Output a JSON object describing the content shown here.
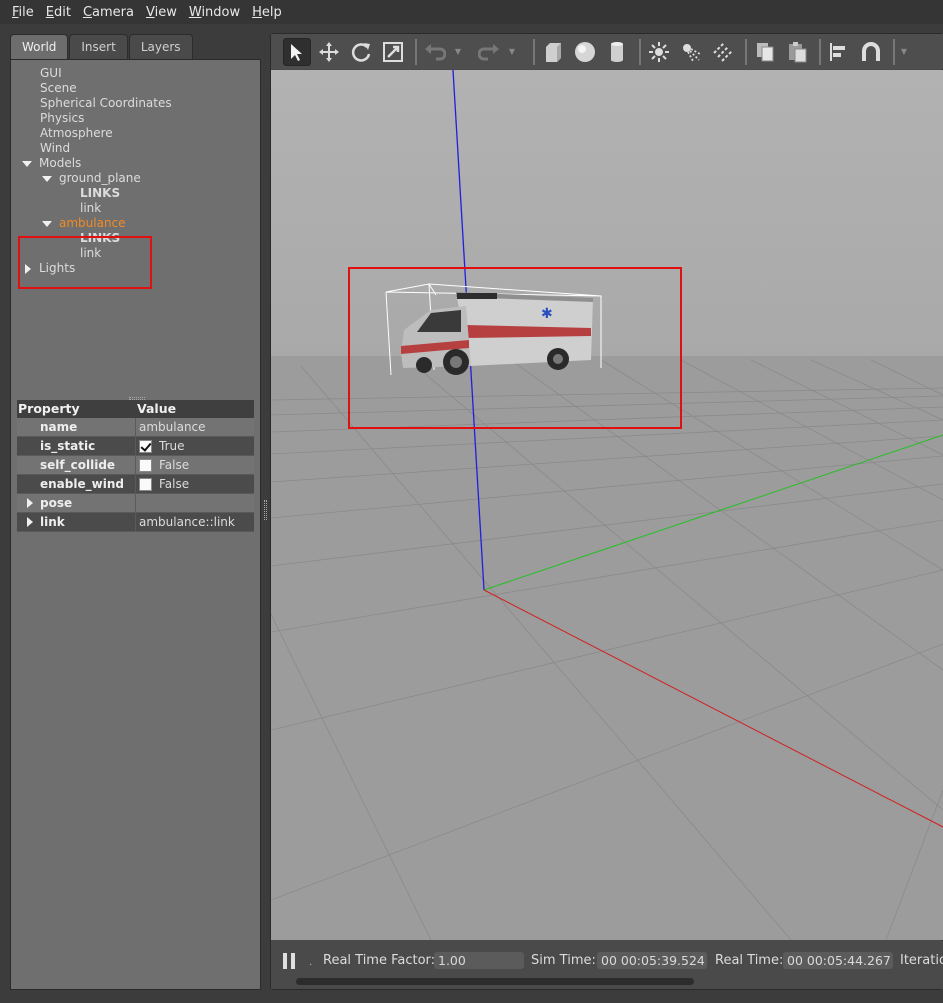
{
  "menu": [
    {
      "label": "File",
      "accel": "F",
      "rest": "ile"
    },
    {
      "label": "Edit",
      "accel": "E",
      "rest": "dit"
    },
    {
      "label": "Camera",
      "accel": "C",
      "rest": "amera"
    },
    {
      "label": "View",
      "accel": "V",
      "rest": "iew"
    },
    {
      "label": "Window",
      "accel": "W",
      "rest": "indow"
    },
    {
      "label": "Help",
      "accel": "H",
      "rest": "elp"
    }
  ],
  "tabs": [
    "World",
    "Insert",
    "Layers"
  ],
  "tree": {
    "gui": "GUI",
    "scene": "Scene",
    "spherical": "Spherical Coordinates",
    "physics": "Physics",
    "atmosphere": "Atmosphere",
    "wind": "Wind",
    "models": "Models",
    "ground_plane": "ground_plane",
    "gp_links": "LINKS",
    "gp_link": "link",
    "ambulance": "ambulance",
    "amb_links": "LINKS",
    "amb_link": "link",
    "lights": "Lights"
  },
  "properties": {
    "header_property": "Property",
    "header_value": "Value",
    "rows": {
      "name": {
        "key": "name",
        "value": "ambulance"
      },
      "is_static": {
        "key": "is_static",
        "value": "True",
        "checked": true
      },
      "self_collide": {
        "key": "self_collide",
        "value": "False",
        "checked": false
      },
      "enable_wind": {
        "key": "enable_wind",
        "value": "False",
        "checked": false
      },
      "pose": {
        "key": "pose",
        "value": ""
      },
      "link": {
        "key": "link",
        "value": "ambulance::link"
      }
    }
  },
  "toolbar_icons": [
    "select-icon",
    "translate-icon",
    "rotate-icon",
    "scale-icon",
    "undo-icon",
    "redo-icon",
    "box-icon",
    "sphere-icon",
    "cylinder-icon",
    "point-light-icon",
    "spot-light-icon",
    "directional-light-icon",
    "copy-icon",
    "paste-icon",
    "align-icon",
    "snap-icon"
  ],
  "status": {
    "rtf_label": "Real Time Factor:",
    "rtf_value": "1.00",
    "sim_label": "Sim Time:",
    "sim_value": "00 00:05:39.524",
    "real_label": "Real Time:",
    "real_value": "00 00:05:44.267",
    "iter_label": "Iteratio"
  },
  "colors": {
    "selection_box": "#e01010",
    "selected_text": "#f08a24",
    "axis_z": "#1f1fe0",
    "axis_y": "#22c022",
    "axis_x": "#d02020"
  }
}
